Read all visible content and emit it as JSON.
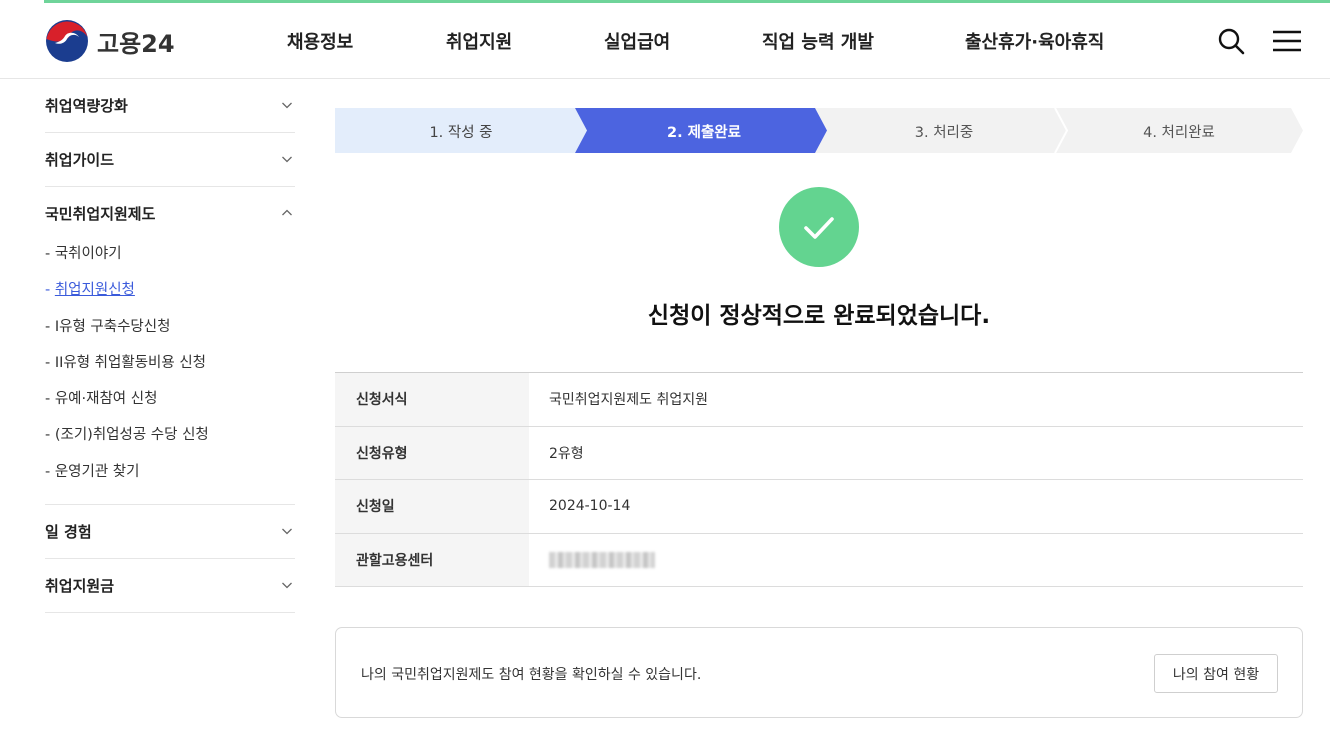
{
  "header": {
    "logo_text": "고용24",
    "nav": [
      "채용정보",
      "취업지원",
      "실업급여",
      "직업 능력 개발",
      "출산휴가·육아휴직"
    ],
    "icons": [
      "search-icon",
      "menu-icon"
    ]
  },
  "sidebar": {
    "groups": [
      {
        "label": "취업역량강화",
        "expanded": false
      },
      {
        "label": "취업가이드",
        "expanded": false
      },
      {
        "label": "국민취업지원제도",
        "expanded": true,
        "items": [
          "- 국취이야기",
          "- 취업지원신청",
          "- I유형 구축수당신청",
          "- II유형 취업활동비용 신청",
          "- 유예·재참여 신청",
          "- (조기)취업성공 수당 신청",
          "- 운영기관 찾기"
        ],
        "active_item": "- 취업지원신청"
      },
      {
        "label": "일 경험",
        "expanded": false
      },
      {
        "label": "취업지원금",
        "expanded": false
      }
    ]
  },
  "steps": {
    "items": [
      "1. 작성 중",
      "2. 제출완료",
      "3. 처리중",
      "4. 처리완료"
    ],
    "current": "2. 제출완료"
  },
  "result": {
    "title": "신청이 정상적으로 완료되었습니다.",
    "icon": "check-circle-icon"
  },
  "info_table": [
    {
      "key": "신청서식",
      "value": "국민취업지원제도 취업지원"
    },
    {
      "key": "신청유형",
      "value": "2유형"
    },
    {
      "key": "신청일",
      "value": "2024-10-14"
    },
    {
      "key": "관할고용센터",
      "value": ""
    }
  ],
  "notice": {
    "text": "나의 국민취업지원제도 참여 현황을 확인하실 수 있습니다.",
    "button_label": "나의 참여 현황"
  },
  "colors": {
    "accent_blue": "#4c64e0",
    "step_done_bg": "#e3edfb",
    "step_pending_bg": "#f2f2f2",
    "success_green": "#63d490",
    "top_bar_green": "#6fd49a"
  }
}
